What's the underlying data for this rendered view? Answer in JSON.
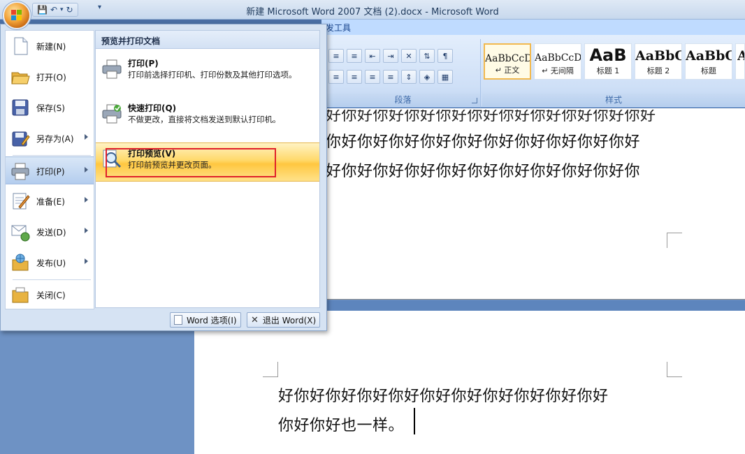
{
  "window": {
    "title": "新建 Microsoft Word 2007 文档 (2).docx - Microsoft Word"
  },
  "ribbon": {
    "tab_partial": "发工具",
    "paragraph_group": "段落",
    "styles_group": "样式",
    "styles": [
      {
        "sample": "AaBbCcD",
        "name": "↵ 正文",
        "selected": true
      },
      {
        "sample": "AaBbCcD",
        "name": "↵ 无间隔",
        "selected": false
      },
      {
        "sample": "AaB",
        "name": "标题 1",
        "selected": false
      },
      {
        "sample": "AaBbC",
        "name": "标题 2",
        "selected": false
      },
      {
        "sample": "AaBbC",
        "name": "标题",
        "selected": false
      },
      {
        "sample": "A",
        "name": "",
        "selected": false
      }
    ]
  },
  "office_menu": {
    "left_items": [
      {
        "label": "新建(N)",
        "icon": "new-document-icon",
        "submenu": false
      },
      {
        "label": "打开(O)",
        "icon": "open-folder-icon",
        "submenu": false
      },
      {
        "label": "保存(S)",
        "icon": "save-disk-icon",
        "submenu": false
      },
      {
        "label": "另存为(A)",
        "icon": "save-as-icon",
        "submenu": true
      },
      {
        "label": "打印(P)",
        "icon": "printer-icon",
        "submenu": true,
        "active": true
      },
      {
        "label": "准备(E)",
        "icon": "prepare-icon",
        "submenu": true
      },
      {
        "label": "发送(D)",
        "icon": "send-icon",
        "submenu": true
      },
      {
        "label": "发布(U)",
        "icon": "publish-icon",
        "submenu": true
      },
      {
        "label": "关闭(C)",
        "icon": "close-folder-icon",
        "submenu": false
      }
    ],
    "panel_title": "预览并打印文档",
    "panel_items": [
      {
        "title": "打印(P)",
        "desc": "打印前选择打印机、打印份数及其他打印选项。"
      },
      {
        "title": "快速打印(Q)",
        "desc": "不做更改，直接将文档发送到默认打印机。"
      },
      {
        "title": "打印预览(V)",
        "desc": "打印前预览并更改页面。"
      }
    ],
    "word_options": "Word 选项(I)",
    "exit_word": "退出 Word(X)"
  },
  "document": {
    "page1_line_top": "好你好你好你好你好你好你好你好你好你好你好",
    "page1_line1": "你好你好你好你好你好你好你好你好你好你好",
    "page1_line2": "好你好你好你好你好你好你好你好你好你好你",
    "page2_line1": "好你好你好你好你好你好你好你好你好你好你好",
    "page2_line2": "你好你好也一样。"
  }
}
